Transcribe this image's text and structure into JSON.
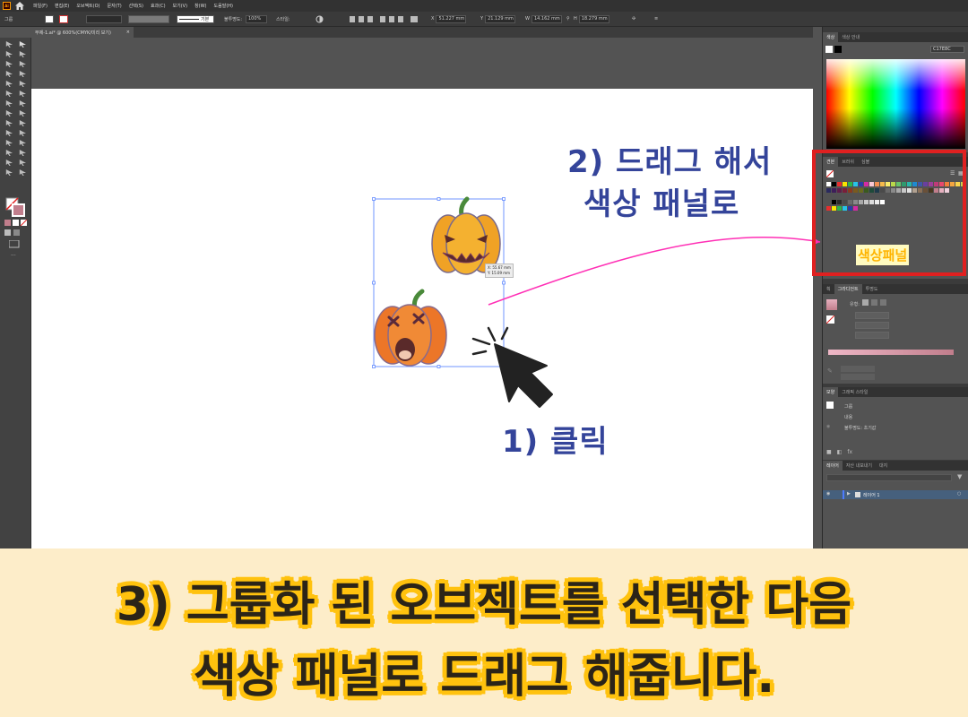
{
  "app": {
    "logo": "Ai"
  },
  "menu": [
    "파일(F)",
    "편집(E)",
    "오브젝트(O)",
    "문자(T)",
    "선택(S)",
    "효과(C)",
    "보기(V)",
    "창(W)",
    "도움말(H)"
  ],
  "control_bar": {
    "selection": "그룹",
    "stroke_style": "기본",
    "opacity_label": "불투명도:",
    "opacity": "100%",
    "style_label": "스타일:",
    "x": "51.227 mm",
    "y": "21.129 mm",
    "w": "14.162 mm",
    "h": "18.279 mm"
  },
  "document_tab": {
    "title": "무제-1.ai* @ 600%(CMYK/미리 보기)",
    "close": "×"
  },
  "selection_tooltip": {
    "x": "X: 55.67 mm",
    "y": "Y: 15.09 mm"
  },
  "panels": {
    "color": {
      "tabs": [
        "색상",
        "색상 안내"
      ],
      "hex": "C17E8C"
    },
    "swatches": {
      "tabs": [
        "견본",
        "브러쉬",
        "심볼"
      ]
    },
    "gradient": {
      "tabs": [
        "획",
        "그라디언트",
        "투명도"
      ],
      "type_label": "유형:"
    },
    "appearance": {
      "tabs": [
        "모양",
        "그래픽 스타일"
      ],
      "rows": [
        "그룹",
        "내용",
        "불투명도: 초기값"
      ]
    },
    "layers": {
      "tabs": [
        "레이어",
        "자산 내보내기",
        "대지"
      ],
      "layer_name": "레이어 1"
    }
  },
  "annotations": {
    "step1": "1) 클릭",
    "step2_line1": "2) 드래그 해서",
    "step2_line2": "색상 패널로",
    "swatch_panel_label": "색상패널"
  },
  "caption": {
    "line1": "3) 그룹화 된 오브젝트를 선택한 다음",
    "line2": "색상 패널로 드래그 해줍니다."
  },
  "colors": {
    "annotation_blue": "#34449a",
    "highlight_red": "#e02020",
    "arrow_pink": "#ff2fb5",
    "caption_outline": "#ffc20e",
    "footer_bg": "#fdedc9",
    "pumpkin_yellow": "#f4a92b",
    "pumpkin_orange": "#ef7a2c"
  }
}
